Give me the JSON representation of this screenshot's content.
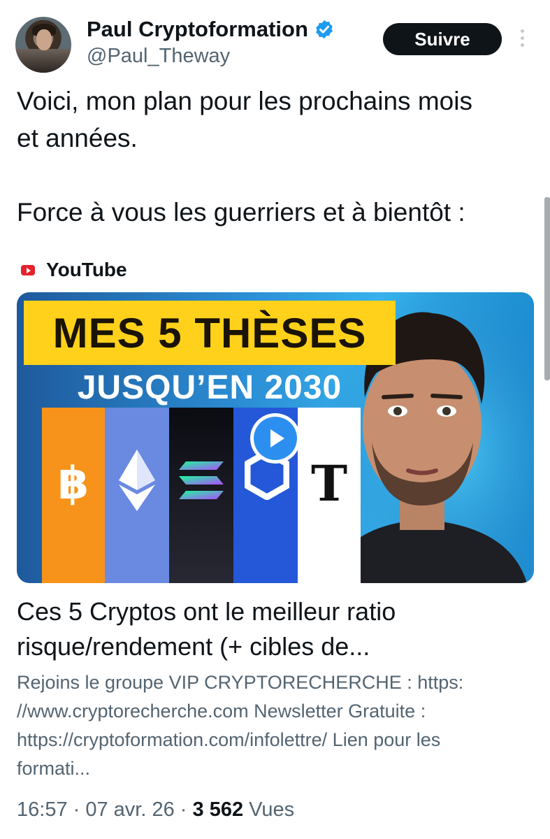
{
  "author": {
    "display_name": "Paul Cryptoformation",
    "handle": "@Paul_Theway",
    "verified_icon": "verified-badge-icon",
    "accent_color": "#1d9bf0"
  },
  "header": {
    "follow_label": "Suivre",
    "more_icon": "more-vertical-icon"
  },
  "tweet": {
    "lines": [
      "Voici, mon plan pour les prochains mois",
      "et années.",
      "Force à vous les guerriers et à bientôt :"
    ]
  },
  "card": {
    "source_icon": "youtube-icon",
    "source_name": "YouTube",
    "thumbnail": {
      "headline": "MES 5 THÈSES",
      "subheadline": "JUSQU’EN 2030",
      "coins": [
        "bitcoin-icon",
        "ethereum-icon",
        "solana-icon",
        "chainlink-icon",
        "bittensor-icon"
      ],
      "btc_symbol": "฿",
      "t_symbol": "T",
      "play_icon": "play-icon"
    },
    "title_lines": [
      "Ces 5 Cryptos ont le meilleur ratio",
      "risque/rendement (+ cibles de..."
    ],
    "description_lines": [
      "Rejoins le groupe VIP CRYPTORECHERCHE : https:",
      "//www.cryptorecherche.com Newsletter Gratuite :",
      "https://cryptoformation.com/infolettre/ Lien pour les",
      "formati..."
    ]
  },
  "meta": {
    "time": "16:57",
    "separator": " · ",
    "date": "07 avr. 26",
    "views_count": "3 562",
    "views_label": " Vues"
  }
}
